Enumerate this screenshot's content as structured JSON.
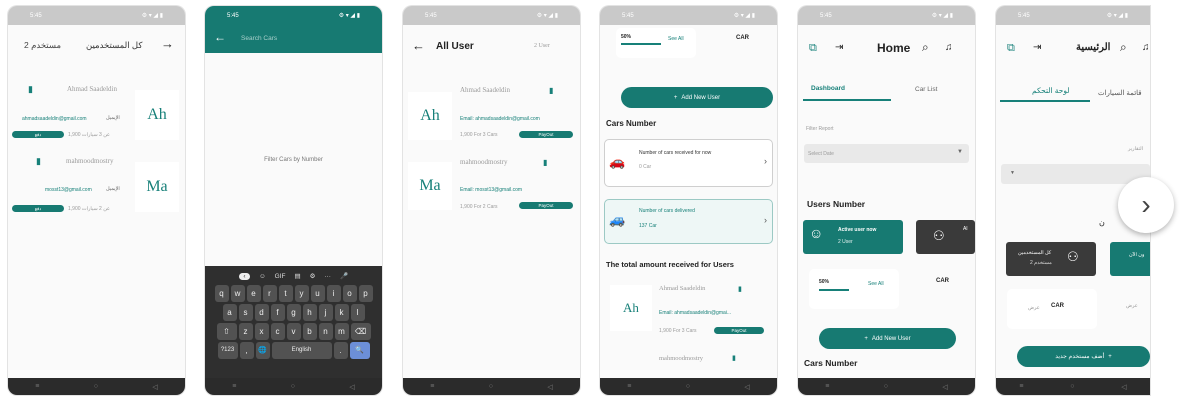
{
  "status_time": "5:45",
  "status_icons": "⚙ ▾ ◢ ▮",
  "nav": {
    "menu": "≡",
    "home": "○",
    "back": "◁"
  },
  "users": [
    {
      "initials": "Ah",
      "name": "Ahmad Saadeldin",
      "email": "ahmadsaadeldin@gmail.com",
      "email_line": "Email: ahmadsaadeldin@gmail.com",
      "cars_line": "1,900 For 3 Cars",
      "cars_rtl": "1,900 عن 3 سيارات",
      "action": "PayOut",
      "action_rtl": "دفع"
    },
    {
      "initials": "Ma",
      "name": "mahmoodmostry",
      "email": "mosst13@gmail.com",
      "email_line": "Email: mosst13@gmail.com",
      "cars_line": "1,900 For 2 Cars",
      "cars_rtl": "1,900 عن 2 سيارات",
      "action": "PayOut",
      "action_rtl": "دفع"
    }
  ],
  "email_label_rtl": "الإيميل",
  "s1": {
    "title": "كل المستخدمين",
    "subtitle": "مستخدم 2"
  },
  "s2": {
    "search_placeholder": "Search Cars",
    "empty_text": "Filter Cars by Number",
    "keyboard": {
      "toolbar": [
        "‹",
        "☺",
        "GIF",
        "▤",
        "⚙",
        "···",
        "🎤"
      ],
      "row1": [
        "q",
        "w",
        "e",
        "r",
        "t",
        "y",
        "u",
        "i",
        "o",
        "p"
      ],
      "row2": [
        "a",
        "s",
        "d",
        "f",
        "g",
        "h",
        "j",
        "k",
        "l"
      ],
      "row3": [
        "z",
        "x",
        "c",
        "v",
        "b",
        "n",
        "m"
      ],
      "shift": "⇧",
      "backspace": "⌫",
      "symbols": "?123",
      "comma": ",",
      "globe": "🌐",
      "space": "English",
      "period": ".",
      "search": "🔍"
    }
  },
  "s3": {
    "title": "All User",
    "count": "2 User"
  },
  "s4": {
    "progress": "50%",
    "see_all": "See All",
    "add_user": "Add New User",
    "cars_number_title": "Cars Number",
    "received_title": "Number of cars received for now",
    "received_value": "0 Car",
    "delivered_title": "Number of cars delivered",
    "delivered_value": "137 Car",
    "total_title": "The total amount received for Users",
    "email_trunc": "Email: ahmadsaadeldin@gmai..."
  },
  "s5": {
    "title": "Home",
    "tab_dashboard": "Dashboard",
    "tab_carlist": "Car List",
    "filter_label": "Filter Report",
    "select_date": "Select Date",
    "users_number_title": "Users Number",
    "active_title": "Active user now",
    "active_value": "2 User",
    "dark_label": "Al",
    "progress": "50%",
    "see_all": "See All",
    "add_user": "Add New User",
    "cars_number_title": "Cars Number"
  },
  "s6": {
    "title": "الرئيسية",
    "tab_control": "لوحة التحكم",
    "tab_cars": "قائمة السيارات",
    "filter_label": "التقارير",
    "dark_title": "كل المستخدمين",
    "dark_value": "2 مستخدم",
    "side_label": "ن",
    "teal_label": "ون الآن",
    "see_all": "عرض",
    "add_user": "أضف مستخدم جديد",
    "car_logo": "CAR"
  },
  "brand_logo": "CAR",
  "next_arrow": "›",
  "colors": {
    "teal": "#177a72",
    "dark": "#3a3a3a"
  }
}
